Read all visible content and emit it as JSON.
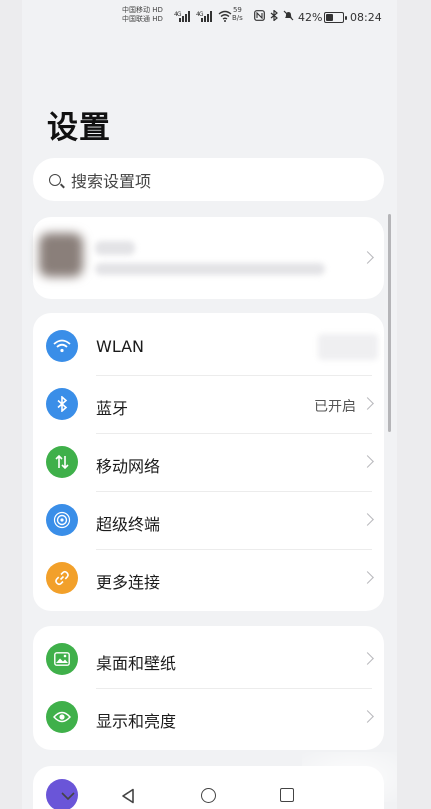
{
  "status_bar": {
    "carrier_1": "中国移动",
    "carrier_1_badge": "HD",
    "carrier_2": "中国联通",
    "carrier_2_badge": "HD",
    "signal_1": "⁴ᴳ",
    "signal_2": "⁴ᴳ",
    "net_speed": "59",
    "net_speed_unit": "B/s",
    "battery_percent": "42%",
    "battery_level": 0.42,
    "time": "08:24",
    "icons": [
      "nfc-icon",
      "bluetooth-icon",
      "mute-icon",
      "battery-icon",
      "wifi-icon",
      "signal-icon"
    ]
  },
  "page": {
    "title": "设置"
  },
  "search": {
    "placeholder": "搜索设置项",
    "icon": "search-icon"
  },
  "connectivity": {
    "items": [
      {
        "label": "WLAN",
        "value": "",
        "icon": "wifi-icon",
        "color": "#3a8ee8"
      },
      {
        "label": "蓝牙",
        "value": "已开启",
        "icon": "bluetooth-icon",
        "color": "#3a8ee8"
      },
      {
        "label": "移动网络",
        "value": "",
        "icon": "mobile-data-icon",
        "color": "#3fb04a"
      },
      {
        "label": "超级终端",
        "value": "",
        "icon": "super-device-icon",
        "color": "#3a8ee8"
      },
      {
        "label": "更多连接",
        "value": "",
        "icon": "link-icon",
        "color": "#f2a02a"
      }
    ]
  },
  "display": {
    "items": [
      {
        "label": "桌面和壁纸",
        "icon": "wallpaper-icon",
        "color": "#3fb04a"
      },
      {
        "label": "显示和亮度",
        "icon": "eye-icon",
        "color": "#3fb04a"
      }
    ]
  },
  "nav": {
    "icons": [
      "collapse-icon",
      "back-icon",
      "home-icon",
      "recents-icon"
    ]
  }
}
